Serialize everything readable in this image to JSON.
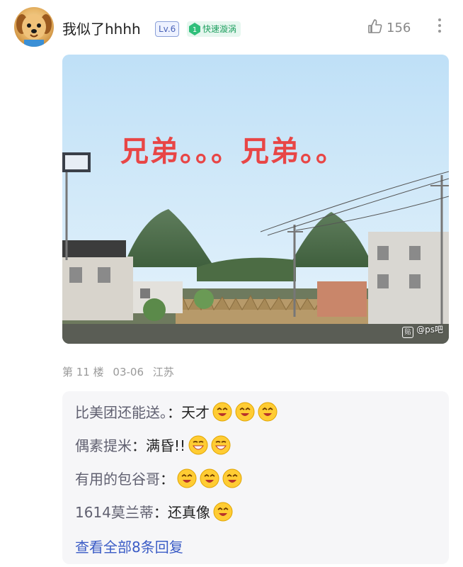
{
  "post": {
    "username": "我似了hhhh",
    "level_badge": "Lv.6",
    "fast_badge_num": "1",
    "fast_badge_label": "快速漩涡",
    "like_count": "156",
    "image": {
      "caption": "兄弟。。。兄弟。。",
      "watermark": "@ps吧",
      "watermark_icon": "贴"
    },
    "meta": {
      "floor": "第 11 楼",
      "date": "03-06",
      "location": "江苏"
    }
  },
  "replies": [
    {
      "author": "比美团还能送。",
      "sep": "：",
      "text": "天才",
      "emojis": [
        "grin-emoji",
        "grin-emoji",
        "grin-emoji"
      ]
    },
    {
      "author": "偶素提米",
      "sep": "：",
      "text": "满昏!!",
      "emojis": [
        "smile-emoji",
        "smile-emoji"
      ]
    },
    {
      "author": "有用的包谷哥",
      "sep": "：",
      "text": "",
      "emojis": [
        "grin-emoji",
        "grin-emoji",
        "grin-emoji"
      ]
    },
    {
      "author": "1614莫兰蒂",
      "sep": "：",
      "text": "还真像",
      "emojis": [
        "grin-emoji"
      ]
    }
  ],
  "view_all": "查看全部8条回复",
  "colors": {
    "accent_link": "#3b5cc6",
    "caption_red": "#e84646",
    "badge_green": "#20a060"
  }
}
